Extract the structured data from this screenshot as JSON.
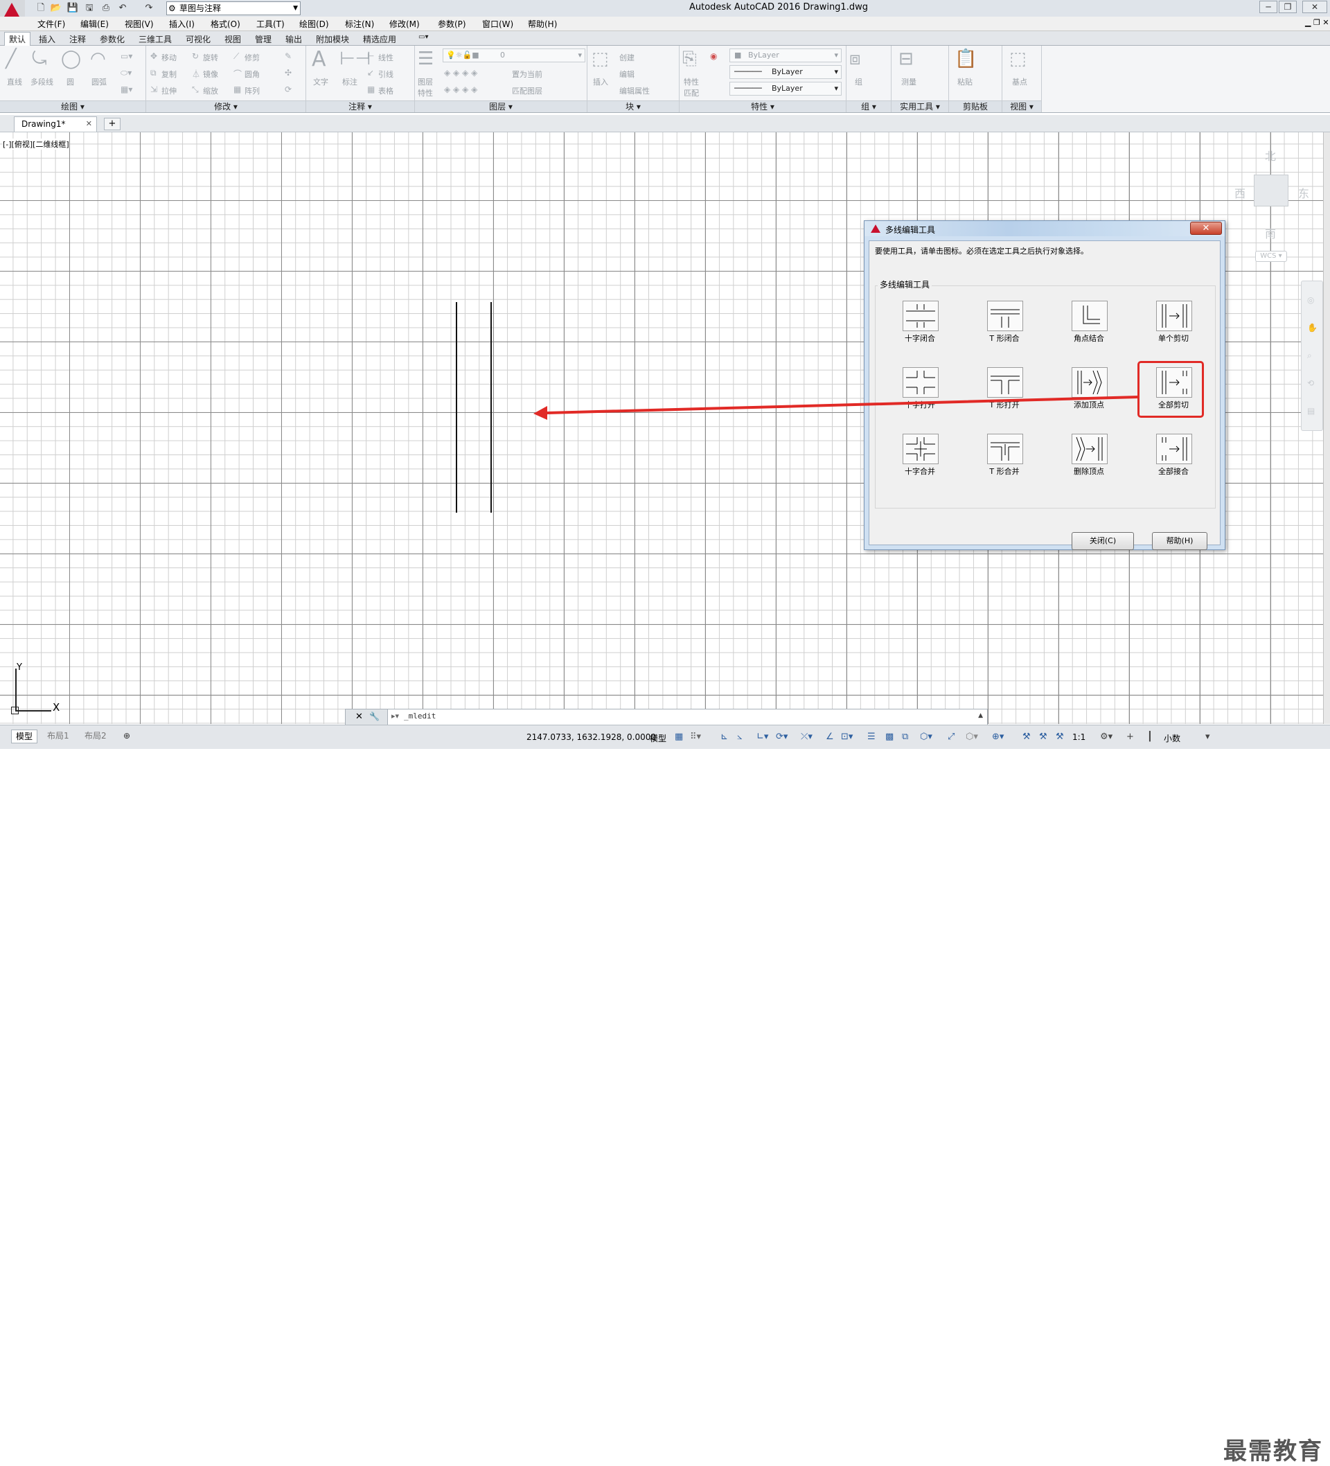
{
  "window": {
    "app_title": "Autodesk AutoCAD 2016    Drawing1.dwg",
    "workspace": "草图与注释"
  },
  "menubar": [
    "文件(F)",
    "编辑(E)",
    "视图(V)",
    "插入(I)",
    "格式(O)",
    "工具(T)",
    "绘图(D)",
    "标注(N)",
    "修改(M)",
    "参数(P)",
    "窗口(W)",
    "帮助(H)"
  ],
  "ribbon_tabs": [
    "默认",
    "插入",
    "注释",
    "参数化",
    "三维工具",
    "可视化",
    "视图",
    "管理",
    "输出",
    "附加模块",
    "精选应用"
  ],
  "ribbon": {
    "panels": [
      "绘图",
      "修改",
      "注释",
      "图层",
      "块",
      "特性",
      "组",
      "实用工具",
      "剪贴板",
      "视图"
    ],
    "draw_tools": [
      "直线",
      "多段线",
      "圆",
      "圆弧"
    ],
    "modify_tools": [
      "移动",
      "旋转",
      "修剪",
      "复制",
      "镜像",
      "圆角",
      "拉伸",
      "缩放",
      "阵列"
    ],
    "annot_tools": [
      "文字",
      "标注",
      "线性",
      "引线",
      "表格"
    ],
    "layer_props": "图层特性",
    "layer_name": "0",
    "layer_set_current": "置为当前",
    "layer_match": "匹配图层",
    "block_tools": [
      "插入",
      "创建",
      "编辑",
      "编辑属性"
    ],
    "match_props": "特性匹配",
    "bylayer": [
      "ByLayer",
      "ByLayer",
      "ByLayer"
    ],
    "group": "组",
    "measure": "测量",
    "paste": "粘贴",
    "base": "基点"
  },
  "file_tab": "Drawing1*",
  "viewport_label": "[-][俯视][二维线框]",
  "viewcube": {
    "north": "北",
    "south": "南",
    "east": "东",
    "west": "西",
    "wcs": "WCS"
  },
  "ucs": {
    "x": "X",
    "y": "Y"
  },
  "command_line": "_mledit",
  "statusbar": {
    "layouts": [
      "模型",
      "布局1",
      "布局2"
    ],
    "coords": "2147.0733, 1632.1928, 0.0000",
    "mode": "模型",
    "scale": "1:1",
    "units": "小数"
  },
  "watermark": "最需教育",
  "dialog": {
    "title": "多线编辑工具",
    "close_x": "✕",
    "instruction": "要使用工具，请单击图标。必须在选定工具之后执行对象选择。",
    "group_title": "多线编辑工具",
    "tools": [
      "十字闭合",
      "T 形闭合",
      "角点结合",
      "单个剪切",
      "十字打开",
      "T 形打开",
      "添加顶点",
      "全部剪切",
      "十字合并",
      "T 形合并",
      "删除顶点",
      "全部接合"
    ],
    "selected_tool": "全部剪切",
    "close_button": "关闭(C)",
    "help_button": "帮助(H)"
  },
  "colors": {
    "accent_red": "#e12a26",
    "app_red": "#c8102e"
  }
}
